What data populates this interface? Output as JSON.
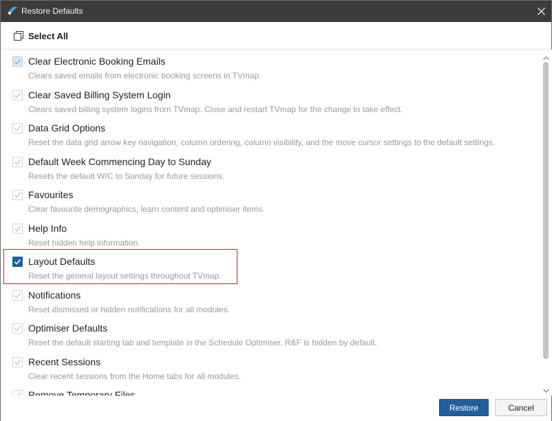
{
  "window": {
    "title": "Restore Defaults"
  },
  "header": {
    "select_all_label": "Select All"
  },
  "items": [
    {
      "title": "Clear Electronic Booking Emails",
      "description": "Clears saved emails from electronic booking screens in TVmap.",
      "checked": true,
      "highlighted": false
    },
    {
      "title": "Clear Saved Billing System Login",
      "description": "Clears saved billing system logins from TVmap. Close and restart TVmap for the change to take effect.",
      "checked": true,
      "highlighted": false
    },
    {
      "title": "Data Grid Options",
      "description": "Reset the data grid arrow key navigation, column ordering, column visibility, and the move cursor settings to the default settings.",
      "checked": true,
      "highlighted": false
    },
    {
      "title": "Default Week Commencing Day to Sunday",
      "description": "Resets the default W/C to Sunday for future sessions.",
      "checked": true,
      "highlighted": false
    },
    {
      "title": "Favourites",
      "description": "Clear favourite demographics, learn content and optimiser items.",
      "checked": true,
      "highlighted": false
    },
    {
      "title": "Help Info",
      "description": "Reset hidden help information.",
      "checked": true,
      "highlighted": false
    },
    {
      "title": "Layout Defaults",
      "description": "Reset the general layout settings throughout TVmap.",
      "checked": true,
      "highlighted": true
    },
    {
      "title": "Notifications",
      "description": "Reset dismissed or hidden notifications for all modules.",
      "checked": true,
      "highlighted": false
    },
    {
      "title": "Optimiser Defaults",
      "description": "Reset the default starting tab and template in the Schedule Optimiser. R&F is hidden by default.",
      "checked": true,
      "highlighted": false
    },
    {
      "title": "Recent Sessions",
      "description": "Clear recent sessions from the Home tabs for all modules.",
      "checked": true,
      "highlighted": false
    },
    {
      "title": "Remove Temporary Files",
      "description": "",
      "checked": true,
      "highlighted": false
    }
  ],
  "footer": {
    "restore_label": "Restore",
    "cancel_label": "Cancel"
  },
  "colors": {
    "accent": "#1f5f9d",
    "titlebar": "#3c3c3c",
    "highlight_border": "#cc1f1f",
    "disabled_check": "#c8c8c8"
  },
  "icons": {
    "app": "tvmap-logo-icon",
    "close": "close-icon",
    "select_all": "select-all-icon",
    "check": "checkmark-icon"
  }
}
